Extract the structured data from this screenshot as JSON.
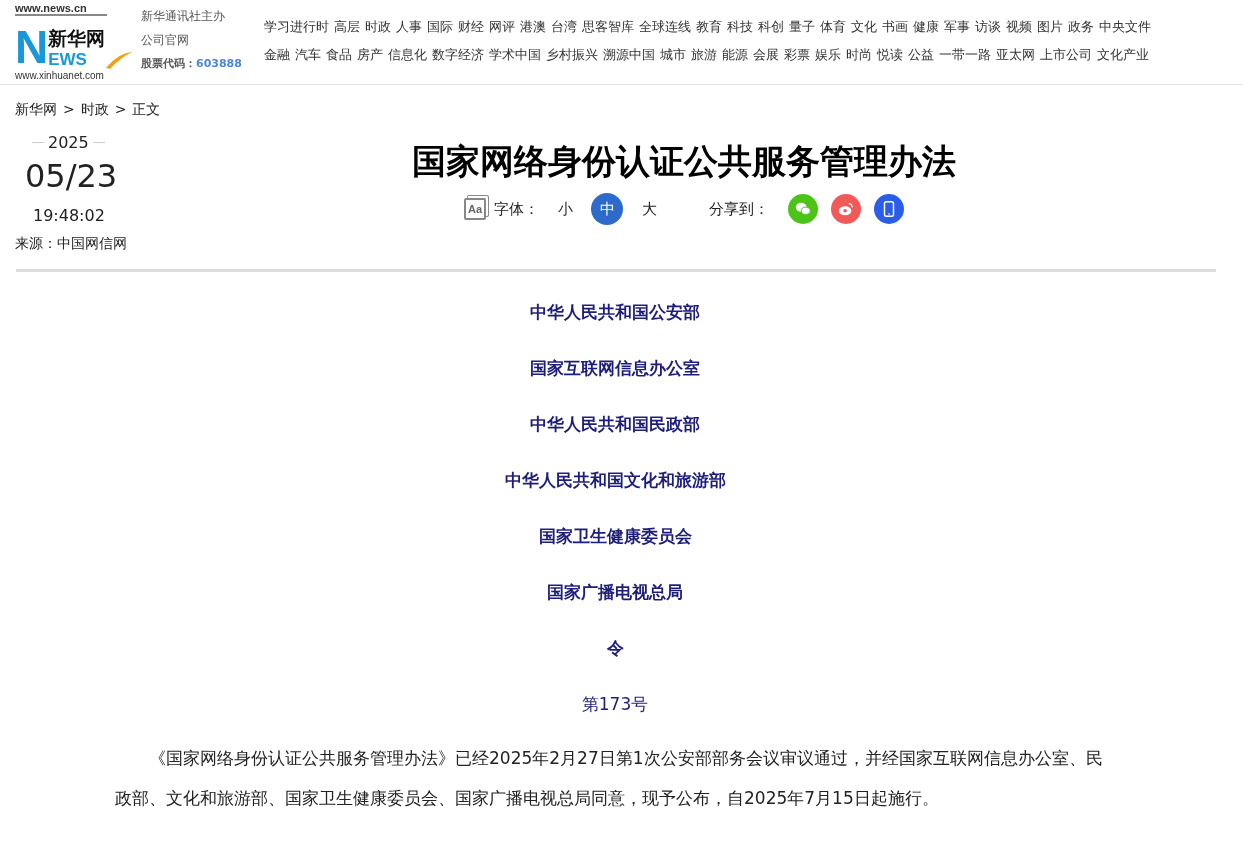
{
  "logo": {
    "top_url": "www.news.cn",
    "name": "新华网",
    "n": "N",
    "news": "EWS",
    "bottom_url": "www.xinhuanet.com"
  },
  "company": {
    "line_1": "新华通讯社主办",
    "line_2": "公司官网",
    "stock_label": "股票代码：",
    "stock_code": "603888"
  },
  "nav_rows": [
    [
      "学习进行时",
      "高层",
      "时政",
      "人事",
      "国际",
      "财经",
      "网评",
      "港澳",
      "台湾",
      "思客智库",
      "全球连线",
      "教育",
      "科技",
      "科创",
      "量子",
      "体育",
      "文化",
      "书画",
      "健康",
      "军事",
      "访谈",
      "视频",
      "图片",
      "政务",
      "中央文件"
    ],
    [
      "金融",
      "汽车",
      "食品",
      "房产",
      "信息化",
      "数字经济",
      "学术中国",
      "乡村振兴",
      "溯源中国",
      "城市",
      "旅游",
      "能源",
      "会展",
      "彩票",
      "娱乐",
      "时尚",
      "悦读",
      "公益",
      "一带一路",
      "亚太网",
      "上市公司",
      "文化产业"
    ]
  ],
  "breadcrumb": [
    "新华网",
    "时政",
    "正文"
  ],
  "breadcrumb_separator": ">",
  "date": {
    "year": "2025",
    "day": "05/23",
    "time": "19:48:02"
  },
  "source": "来源：中国网信网",
  "title": "国家网络身份认证公共服务管理办法",
  "font_tool": {
    "icon_text": "Aa",
    "label": "字体：",
    "sizes": [
      {
        "label": "小",
        "selected": false
      },
      {
        "label": "中",
        "selected": true
      },
      {
        "label": "大",
        "selected": false
      }
    ]
  },
  "share": {
    "label": "分享到：",
    "targets": [
      {
        "kind": "wechat",
        "color": "#4cc417"
      },
      {
        "kind": "weibo",
        "color": "#f25a5a"
      },
      {
        "kind": "mobile",
        "color": "#2b5ee8"
      }
    ]
  },
  "article": {
    "headings": [
      "中华人民共和国公安部",
      "国家互联网信息办公室",
      "中华人民共和国民政部",
      "中华人民共和国文化和旅游部",
      "国家卫生健康委员会",
      "国家广播电视总局",
      "令"
    ],
    "number": "第173号",
    "paragraph": "《国家网络身份认证公共服务管理办法》已经2025年2月27日第1次公安部部务会议审议通过，并经国家互联网信息办公室、民政部、文化和旅游部、国家卫生健康委员会、国家广播电视总局同意，现予公布，自2025年7月15日起施行。"
  }
}
